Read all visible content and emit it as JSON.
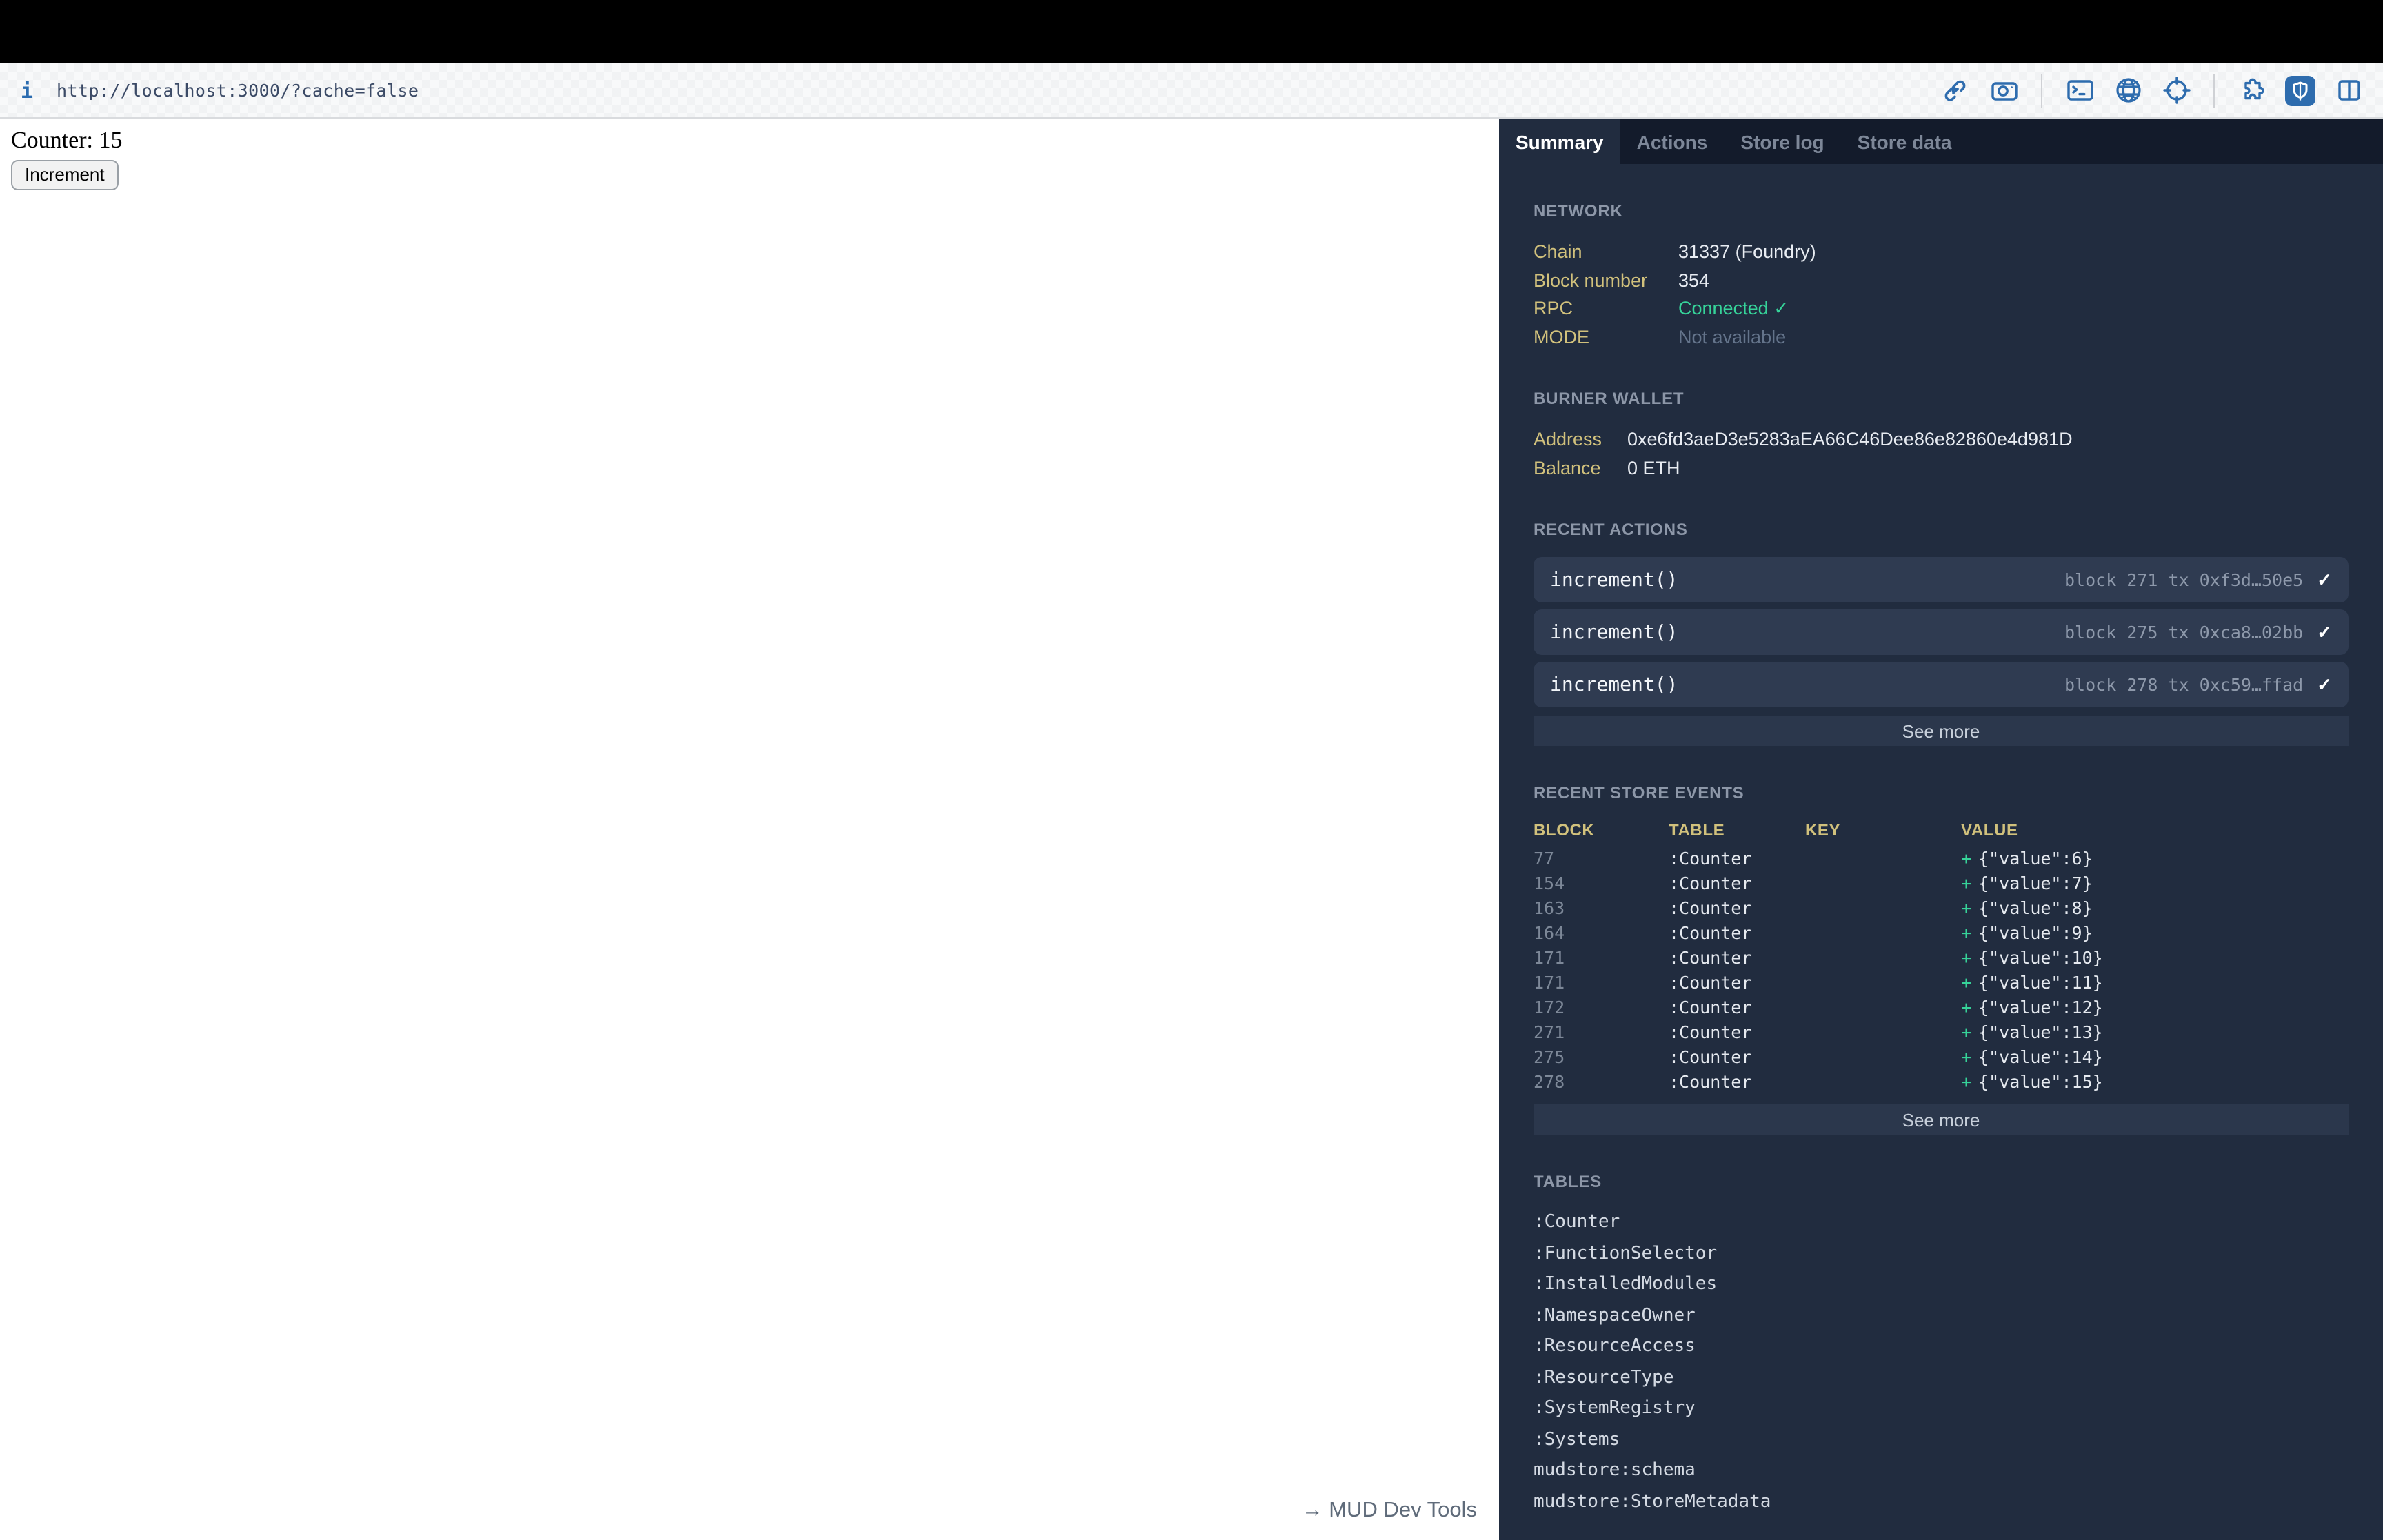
{
  "browser": {
    "url": "http://localhost:3000/?cache=false",
    "info_icon": "i",
    "toolbar_icons": [
      "link-icon",
      "camera-icon",
      "terminal-icon",
      "globe-icon",
      "crosshair-icon",
      "puzzle-icon",
      "shield-icon",
      "columns-icon"
    ]
  },
  "page": {
    "counter_text": "Counter: 15",
    "increment_button": "Increment",
    "devtools_toggle": "→ MUD Dev Tools"
  },
  "colors": {
    "accent_amber": "#d1c17c",
    "accent_green": "#36d399",
    "panel_bg": "#212c3f",
    "tabbar_bg": "#131b2b",
    "icon_blue": "#2e6cae"
  },
  "devtools": {
    "tabs": [
      {
        "label": "Summary"
      },
      {
        "label": "Actions"
      },
      {
        "label": "Store log"
      },
      {
        "label": "Store data"
      }
    ],
    "network": {
      "title": "NETWORK",
      "rows": [
        {
          "label": "Chain",
          "value": "31337 (Foundry)"
        },
        {
          "label": "Block number",
          "value": "354"
        },
        {
          "label": "RPC",
          "value": "Connected ✓"
        },
        {
          "label": "MODE",
          "value": "Not available"
        }
      ]
    },
    "burner_wallet": {
      "title": "BURNER WALLET",
      "rows": [
        {
          "label": "Address",
          "value": "0xe6fd3aeD3e5283aEA66C46Dee86e82860e4d981D"
        },
        {
          "label": "Balance",
          "value": "0 ETH"
        }
      ]
    },
    "recent_actions": {
      "title": "RECENT ACTIONS",
      "see_more": "See more",
      "items": [
        {
          "fn": "increment()",
          "meta": "block 271 tx 0xf3d…50e5",
          "check": "✓"
        },
        {
          "fn": "increment()",
          "meta": "block 275 tx 0xca8…02bb",
          "check": "✓"
        },
        {
          "fn": "increment()",
          "meta": "block 278 tx 0xc59…ffad",
          "check": "✓"
        }
      ]
    },
    "store_events": {
      "title": "RECENT STORE EVENTS",
      "see_more": "See more",
      "columns": {
        "block": "BLOCK",
        "table": "TABLE",
        "key": "KEY",
        "value": "VALUE"
      },
      "rows": [
        {
          "block": "77",
          "table": ":Counter",
          "key": "",
          "plus": "+",
          "value": "{\"value\":6}"
        },
        {
          "block": "154",
          "table": ":Counter",
          "key": "",
          "plus": "+",
          "value": "{\"value\":7}"
        },
        {
          "block": "163",
          "table": ":Counter",
          "key": "",
          "plus": "+",
          "value": "{\"value\":8}"
        },
        {
          "block": "164",
          "table": ":Counter",
          "key": "",
          "plus": "+",
          "value": "{\"value\":9}"
        },
        {
          "block": "171",
          "table": ":Counter",
          "key": "",
          "plus": "+",
          "value": "{\"value\":10}"
        },
        {
          "block": "171",
          "table": ":Counter",
          "key": "",
          "plus": "+",
          "value": "{\"value\":11}"
        },
        {
          "block": "172",
          "table": ":Counter",
          "key": "",
          "plus": "+",
          "value": "{\"value\":12}"
        },
        {
          "block": "271",
          "table": ":Counter",
          "key": "",
          "plus": "+",
          "value": "{\"value\":13}"
        },
        {
          "block": "275",
          "table": ":Counter",
          "key": "",
          "plus": "+",
          "value": "{\"value\":14}"
        },
        {
          "block": "278",
          "table": ":Counter",
          "key": "",
          "plus": "+",
          "value": "{\"value\":15}"
        }
      ]
    },
    "tables": {
      "title": "TABLES",
      "items": [
        ":Counter",
        ":FunctionSelector",
        ":InstalledModules",
        ":NamespaceOwner",
        ":ResourceAccess",
        ":ResourceType",
        ":SystemRegistry",
        ":Systems",
        "mudstore:schema",
        "mudstore:StoreMetadata"
      ]
    }
  }
}
